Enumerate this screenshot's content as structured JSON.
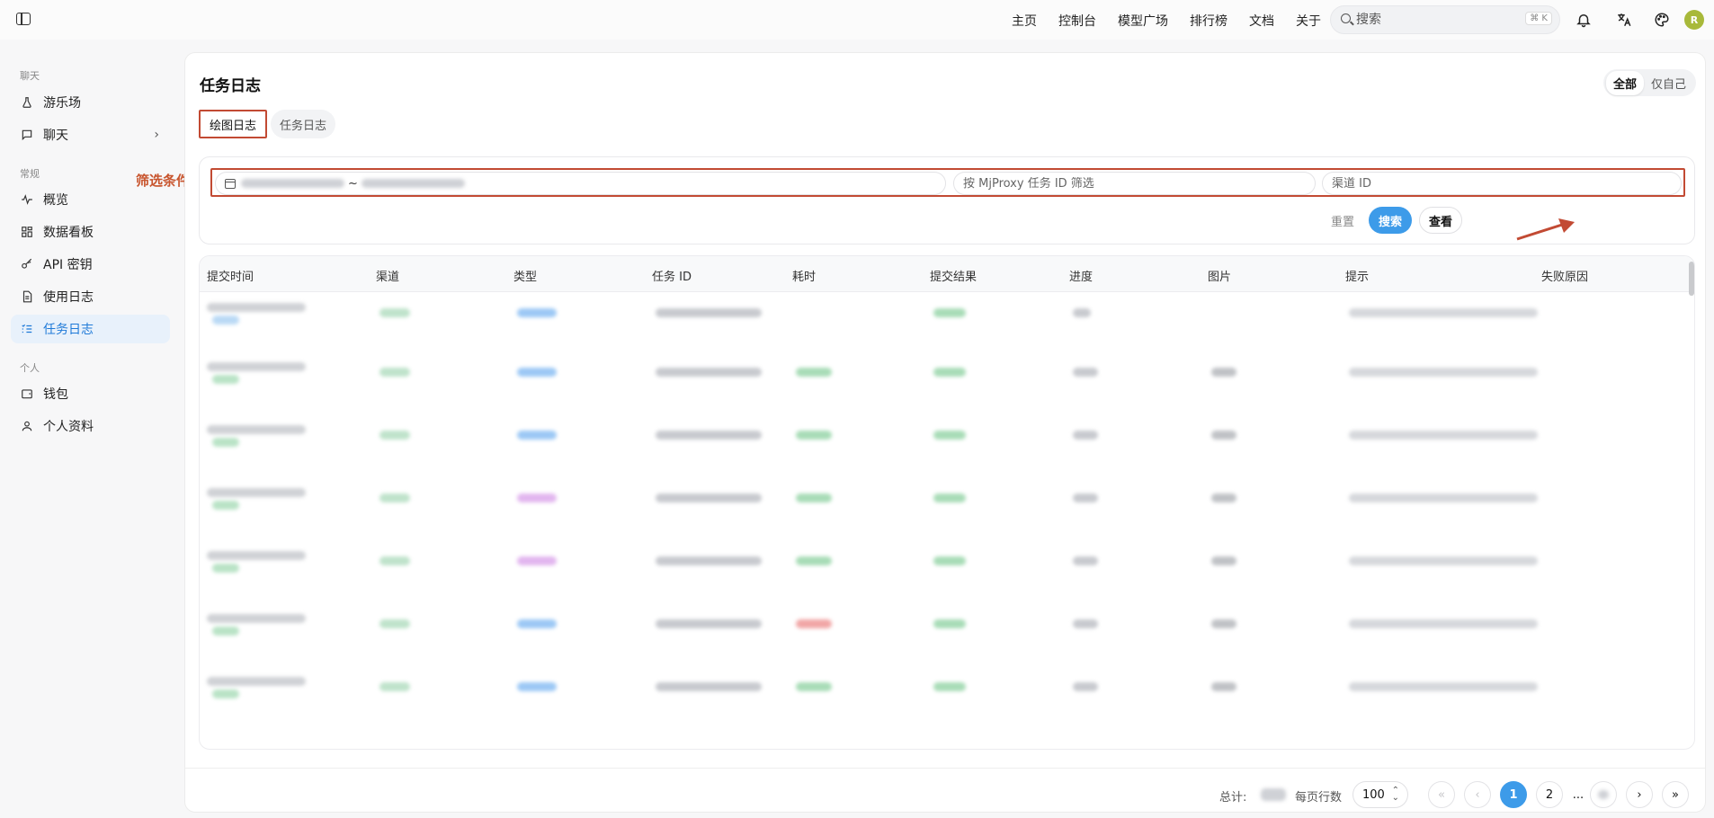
{
  "topbar": {
    "nav": [
      "主页",
      "控制台",
      "模型广场",
      "排行榜",
      "文档",
      "关于"
    ],
    "search_placeholder": "搜索",
    "search_shortcut": "⌘ K",
    "avatar_initial": "R",
    "avatar_color": "#a8b93a"
  },
  "sidebar": {
    "section_chat": "聊天",
    "section_general": "常规",
    "section_personal": "个人",
    "items": {
      "playground": "游乐场",
      "chat": "聊天",
      "overview": "概览",
      "dashboard": "数据看板",
      "api_keys": "API 密钥",
      "usage_logs": "使用日志",
      "task_logs": "任务日志",
      "wallet": "钱包",
      "profile": "个人资料"
    }
  },
  "main": {
    "title": "任务日志",
    "scope": [
      "全部",
      "仅自己"
    ],
    "tabs": [
      "绘图日志",
      "任务日志"
    ],
    "annotation_filter": "筛选条件",
    "filters": {
      "date_range_separator": "~",
      "task_id_placeholder": "按 MjProxy 任务 ID 筛选",
      "channel_placeholder": "渠道 ID"
    },
    "buttons": {
      "reset": "重置",
      "search": "搜索",
      "view": "查看"
    },
    "columns": [
      "提交时间",
      "渠道",
      "类型",
      "任务 ID",
      "耗时",
      "提交结果",
      "进度",
      "图片",
      "提示",
      "失败原因"
    ],
    "accent_color": "#3d9be9",
    "annotation_color": "#c24a33"
  },
  "footer": {
    "total_label": "总计:",
    "per_page_label": "每页行数",
    "page_size": "100",
    "pages": [
      "1",
      "2"
    ],
    "ellipsis": "..."
  }
}
